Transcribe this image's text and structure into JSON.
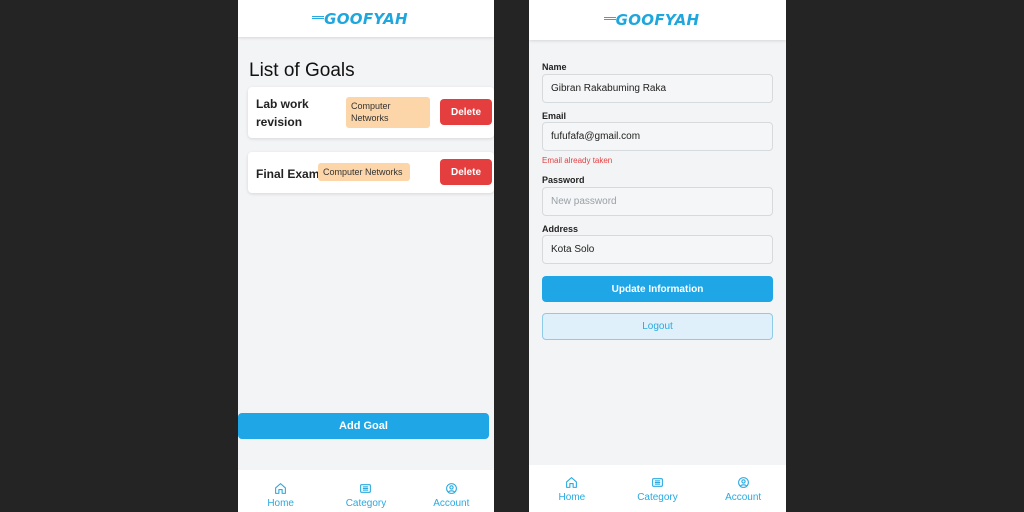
{
  "brand": {
    "logo_text": "GOOFYAH",
    "color": "#1ea6dd"
  },
  "left_screen": {
    "title": "List of Goals",
    "goals": [
      {
        "title": "Lab work revision",
        "category": "Computer Networks",
        "delete_label": "Delete"
      },
      {
        "title": "Final Exam",
        "category": "Computer Networks",
        "delete_label": "Delete"
      }
    ],
    "add_goal_label": "Add Goal"
  },
  "right_screen": {
    "fields": {
      "name": {
        "label": "Name",
        "value": "Gibran Rakabuming Raka"
      },
      "email": {
        "label": "Email",
        "value": "fufufafa@gmail.com",
        "error": "Email already taken"
      },
      "password": {
        "label": "Password",
        "value": "",
        "placeholder": "New password"
      },
      "address": {
        "label": "Address",
        "value": "Kota Solo"
      }
    },
    "update_label": "Update Information",
    "logout_label": "Logout"
  },
  "nav": {
    "items": [
      {
        "label": "Home",
        "icon": "home-icon"
      },
      {
        "label": "Category",
        "icon": "category-icon"
      },
      {
        "label": "Account",
        "icon": "account-icon"
      }
    ]
  },
  "colors": {
    "primary": "#1ea6e6",
    "danger": "#e53e3e",
    "tag_bg": "#fcd6a9",
    "logout_bg": "#e0f0fa"
  }
}
